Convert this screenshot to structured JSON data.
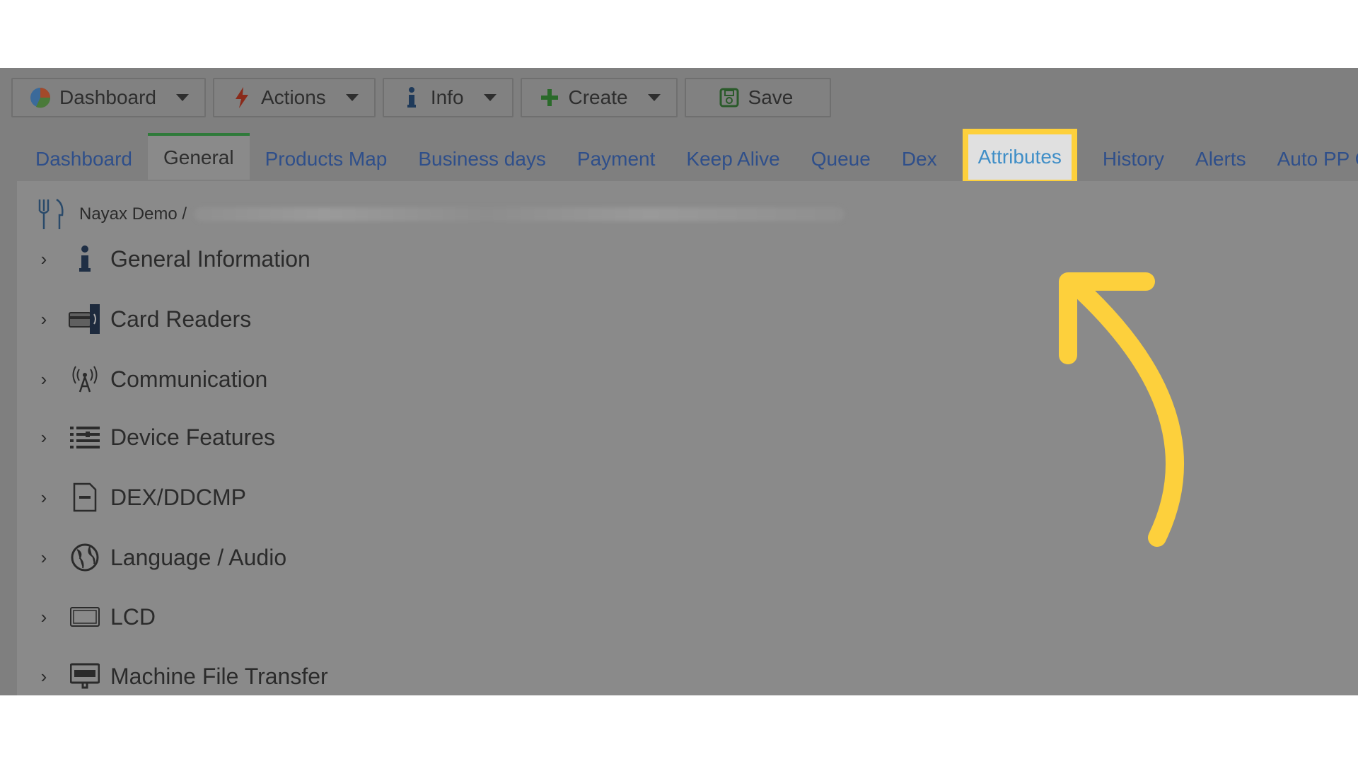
{
  "toolbar": {
    "dashboard_label": "Dashboard",
    "actions_label": "Actions",
    "info_label": "Info",
    "create_label": "Create",
    "save_label": "Save"
  },
  "tabs": [
    {
      "label": "Dashboard"
    },
    {
      "label": "General"
    },
    {
      "label": "Products Map"
    },
    {
      "label": "Business days"
    },
    {
      "label": "Payment"
    },
    {
      "label": "Keep Alive"
    },
    {
      "label": "Queue"
    },
    {
      "label": "Dex"
    },
    {
      "label": "Attributes"
    },
    {
      "label": "History"
    },
    {
      "label": "Alerts"
    },
    {
      "label": "Auto PP Car"
    }
  ],
  "active_tab": "General",
  "highlighted_tab": "Attributes",
  "breadcrumb": {
    "root": "Nayax Demo /"
  },
  "tree": [
    {
      "label": "General Information",
      "icon": "info-icon"
    },
    {
      "label": "Card Readers",
      "icon": "card-reader-icon"
    },
    {
      "label": "Communication",
      "icon": "antenna-icon"
    },
    {
      "label": "Device Features",
      "icon": "features-list-icon"
    },
    {
      "label": "DEX/DDCMP",
      "icon": "dex-icon"
    },
    {
      "label": "Language / Audio",
      "icon": "globe-icon"
    },
    {
      "label": "LCD",
      "icon": "lcd-icon"
    },
    {
      "label": "Machine File Transfer",
      "icon": "ftp-icon"
    }
  ],
  "colors": {
    "overlay_gray": "#7f7f7f",
    "highlight_yellow": "#fdd03c",
    "tab_link": "#2f4f8a",
    "active_tab_border": "#2f7a3a"
  }
}
